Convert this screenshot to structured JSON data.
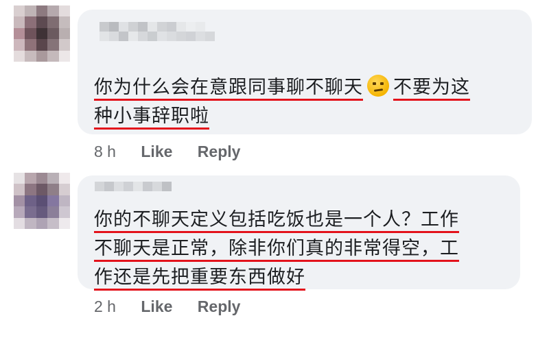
{
  "comments": [
    {
      "lines": [
        {
          "text": "你为什么会在意跟同事聊不聊天",
          "emoji": "raised-eyebrow-emoji",
          "after": "不要为这"
        },
        {
          "text": "种小事辞职啦"
        }
      ],
      "time": "8 h",
      "like_label": "Like",
      "reply_label": "Reply"
    },
    {
      "lines": [
        {
          "text": "你的不聊天定义包括吃饭也是一个人？工作"
        },
        {
          "text": "不聊天是正常，除非你们真的非常得空，工"
        },
        {
          "text": "作还是先把重要东西做好"
        }
      ],
      "time": "2 h",
      "like_label": "Like",
      "reply_label": "Reply"
    }
  ],
  "colors": {
    "bubble": "#f0f2f5",
    "underline": "#e3121b",
    "meta_text": "#65676b"
  }
}
